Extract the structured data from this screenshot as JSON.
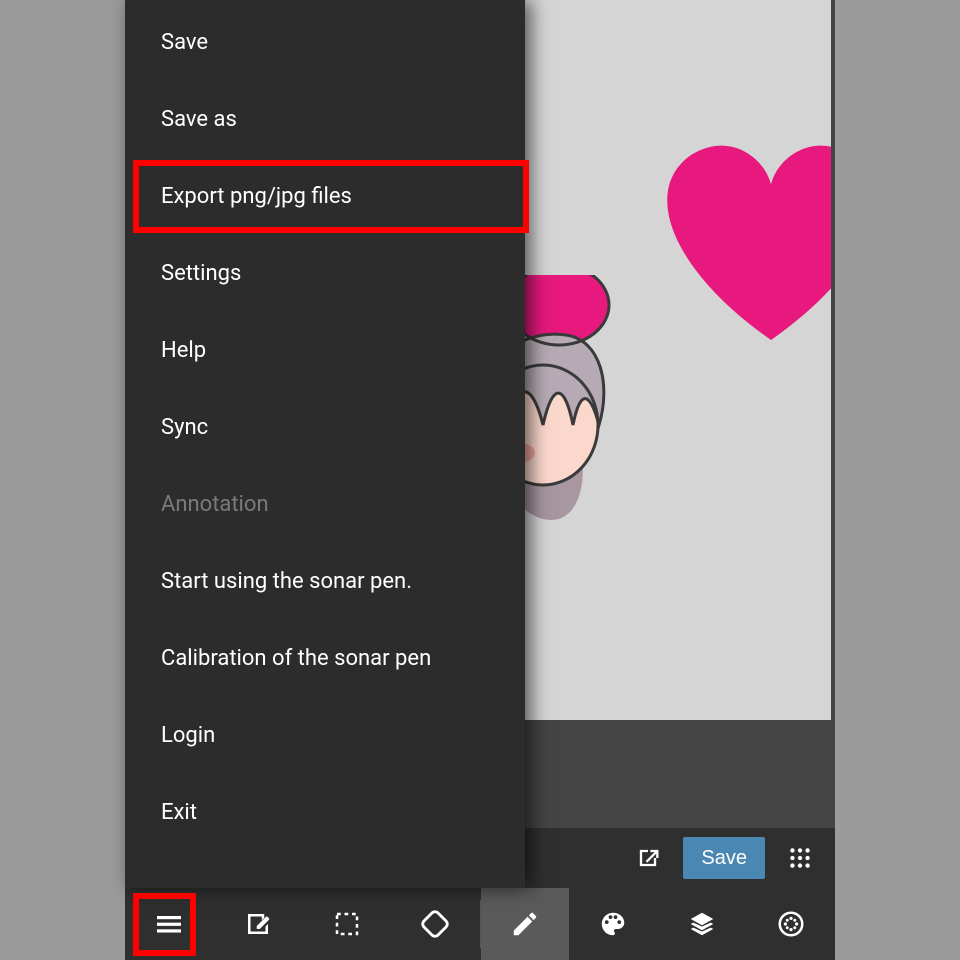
{
  "menu": {
    "items": [
      {
        "label": "Save",
        "name": "menu-save",
        "enabled": true
      },
      {
        "label": "Save as",
        "name": "menu-save-as",
        "enabled": true
      },
      {
        "label": "Export png/jpg files",
        "name": "menu-export-png-jpg",
        "enabled": true
      },
      {
        "label": "Settings",
        "name": "menu-settings",
        "enabled": true
      },
      {
        "label": "Help",
        "name": "menu-help",
        "enabled": true
      },
      {
        "label": "Sync",
        "name": "menu-sync",
        "enabled": true
      },
      {
        "label": "Annotation",
        "name": "menu-annotation",
        "enabled": false
      },
      {
        "label": "Start using the sonar pen.",
        "name": "menu-sonar-pen-start",
        "enabled": true
      },
      {
        "label": "Calibration of the sonar pen",
        "name": "menu-sonar-pen-calibrate",
        "enabled": true
      },
      {
        "label": "Login",
        "name": "menu-login",
        "enabled": true
      },
      {
        "label": "Exit",
        "name": "menu-exit",
        "enabled": true
      }
    ]
  },
  "action_bar": {
    "open_icon": "open-external-icon",
    "save_label": "Save",
    "apps_icon": "grid-apps-icon"
  },
  "toolbar": {
    "items": [
      {
        "name": "hamburger-menu-icon",
        "selected": false
      },
      {
        "name": "edit-new-icon",
        "selected": false
      },
      {
        "name": "selection-dashed-icon",
        "selected": false
      },
      {
        "name": "rotate-icon",
        "selected": false
      },
      {
        "name": "pencil-tool-icon",
        "selected": true
      },
      {
        "name": "palette-icon",
        "selected": false
      },
      {
        "name": "layers-icon",
        "selected": false
      },
      {
        "name": "target-circle-icon",
        "selected": false
      }
    ]
  },
  "colors": {
    "accent": "#4a87b3",
    "highlight": "#ff0000",
    "heart": "#e7187e",
    "canvas": "#d6d5d5"
  },
  "highlighted": {
    "menu_item": "menu-export-png-jpg",
    "toolbar_item": "hamburger-menu-icon"
  }
}
